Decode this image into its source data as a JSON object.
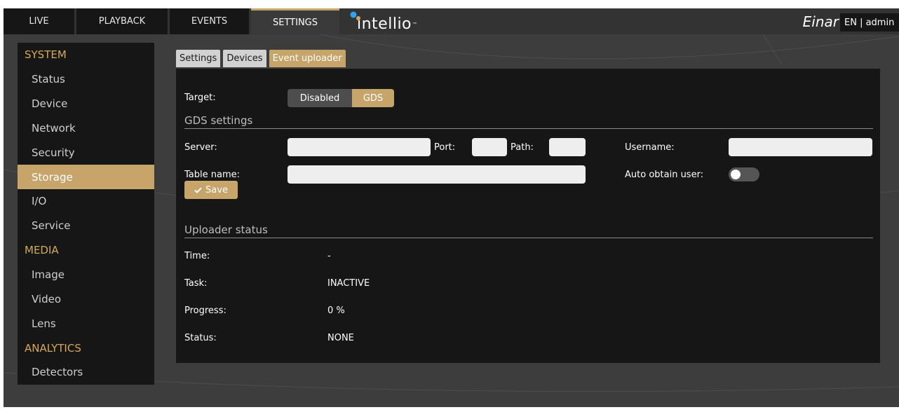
{
  "topnav": {
    "tabs": [
      {
        "label": "LIVE"
      },
      {
        "label": "PLAYBACK"
      },
      {
        "label": "EVENTS"
      },
      {
        "label": "SETTINGS"
      }
    ],
    "active_tab": "SETTINGS",
    "logo_text": "intellio",
    "logo_tm": "™",
    "device_name": "Einar",
    "lang_user": "EN | admin"
  },
  "sidebar": {
    "items": [
      {
        "label": "SYSTEM",
        "type": "header"
      },
      {
        "label": "Status"
      },
      {
        "label": "Device"
      },
      {
        "label": "Network"
      },
      {
        "label": "Security"
      },
      {
        "label": "Storage",
        "active": true
      },
      {
        "label": "I/O"
      },
      {
        "label": "Service"
      },
      {
        "label": "MEDIA",
        "type": "header"
      },
      {
        "label": "Image"
      },
      {
        "label": "Video"
      },
      {
        "label": "Lens"
      },
      {
        "label": "ANALYTICS",
        "type": "header"
      },
      {
        "label": "Detectors"
      }
    ]
  },
  "subtabs": [
    {
      "label": "Settings"
    },
    {
      "label": "Devices"
    },
    {
      "label": "Event uploader",
      "active": true
    }
  ],
  "uploader": {
    "target_label": "Target:",
    "target_options": [
      "Disabled",
      "GDS"
    ],
    "target_selected": "GDS",
    "gds_title": "GDS settings",
    "server_label": "Server:",
    "server_value": "",
    "port_label": "Port:",
    "port_value": "",
    "path_label": "Path:",
    "path_value": "",
    "username_label": "Username:",
    "username_value": "",
    "table_label": "Table name:",
    "table_value": "",
    "auto_label": "Auto obtain user:",
    "auto_obtain_user": false,
    "save_label": "Save",
    "status_title": "Uploader status",
    "status_rows": [
      {
        "label": "Time:",
        "value": "-"
      },
      {
        "label": "Task:",
        "value": "INACTIVE"
      },
      {
        "label": "Progress:",
        "value": "0 %"
      },
      {
        "label": "Status:",
        "value": "NONE"
      }
    ]
  },
  "colors": {
    "accent": "#c7a46a",
    "sidebar_header": "#d5a95a",
    "panel_bg": "#161616",
    "app_bg": "#3d3d3d",
    "logo_dot_blue": "#2ea3f2"
  },
  "icons": {
    "save": "check-icon"
  }
}
